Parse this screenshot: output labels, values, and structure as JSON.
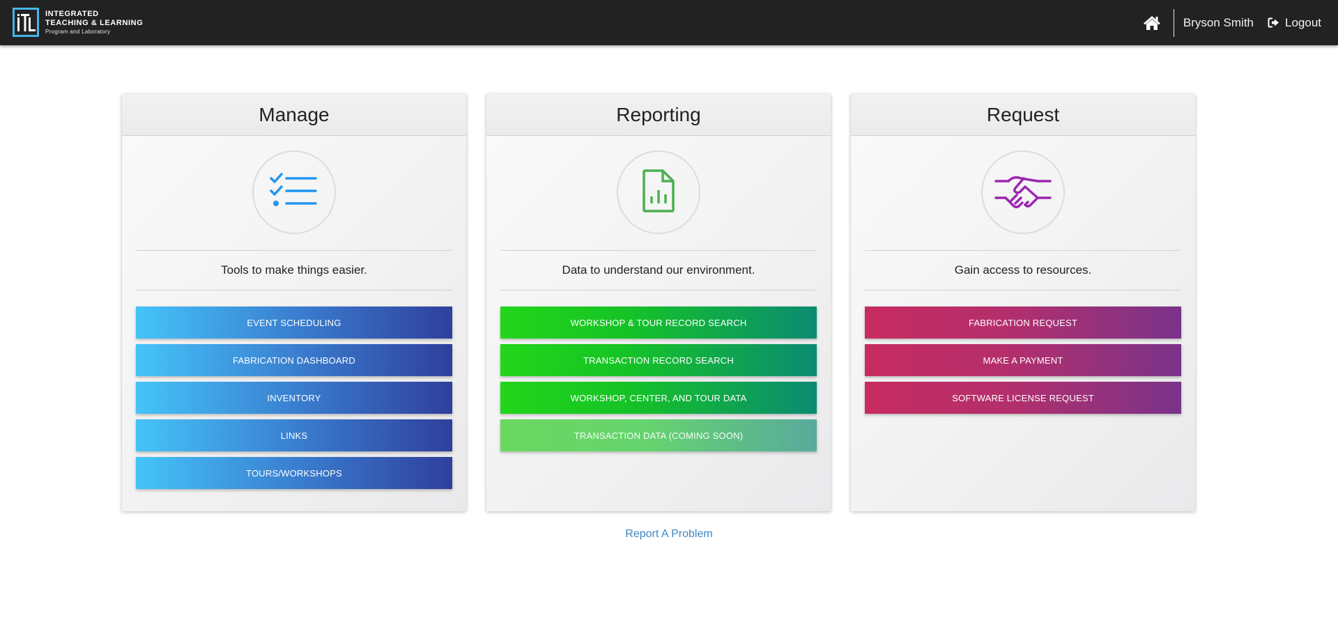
{
  "header": {
    "brand": {
      "line1": "INTEGRATED",
      "line2": "TEACHING & LEARNING",
      "line3": "Program and Laboratory",
      "accent_color": "#45b6e6"
    },
    "user_name": "Bryson Smith",
    "logout_label": "Logout",
    "home_icon": "home-icon",
    "logout_icon": "sign-out-icon"
  },
  "panels": [
    {
      "title": "Manage",
      "icon": "checklist-icon",
      "icon_color": "#2196f3",
      "description": "Tools to make things easier.",
      "buttons": [
        "EVENT SCHEDULING",
        "FABRICATION DASHBOARD",
        "INVENTORY",
        "LINKS",
        "TOURS/WORKSHOPS"
      ]
    },
    {
      "title": "Reporting",
      "icon": "file-chart-icon",
      "icon_color": "#4caf50",
      "description": "Data to understand our environment.",
      "buttons": [
        "WORKSHOP & TOUR RECORD SEARCH",
        "TRANSACTION RECORD SEARCH",
        "WORKSHOP, CENTER, AND TOUR DATA",
        "TRANSACTION DATA (COMING SOON)"
      ]
    },
    {
      "title": "Request",
      "icon": "handshake-icon",
      "icon_color": "#9c27b0",
      "description": "Gain access to resources.",
      "buttons": [
        "FABRICATION REQUEST",
        "MAKE A PAYMENT",
        "SOFTWARE LICENSE REQUEST"
      ]
    }
  ],
  "footer": {
    "report_link": "Report A Problem"
  }
}
